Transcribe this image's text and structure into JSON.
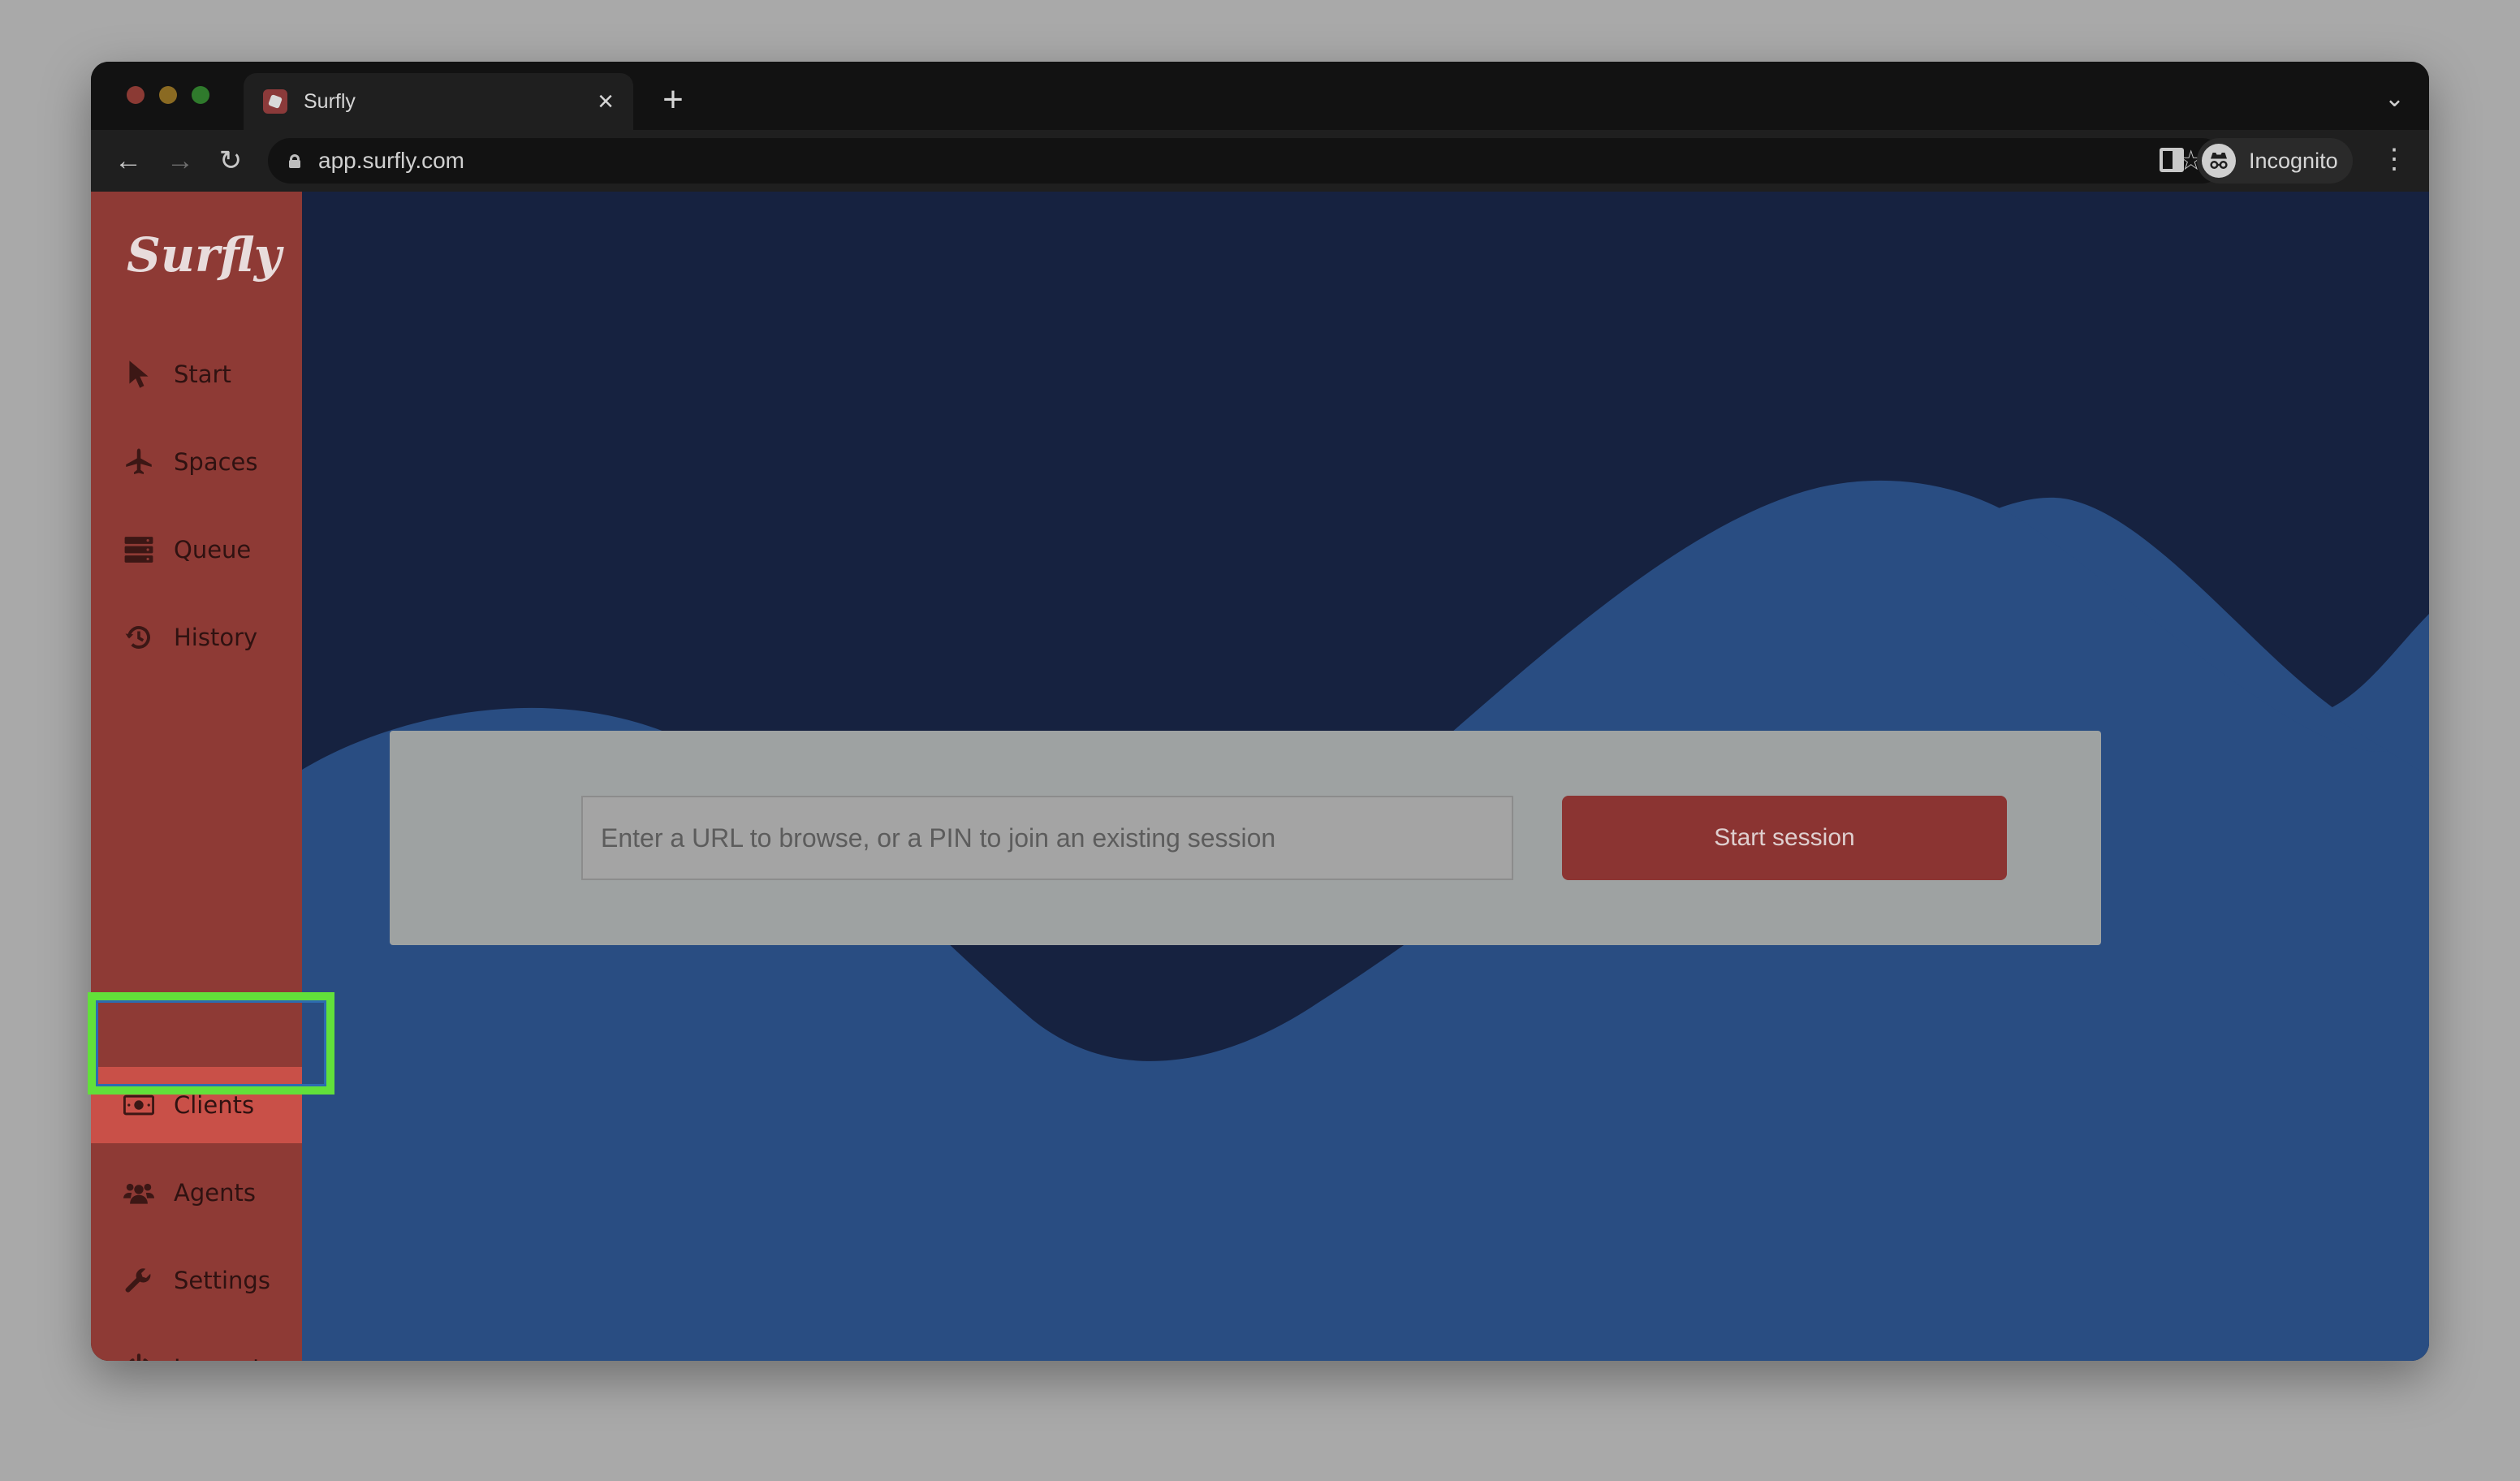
{
  "browser": {
    "tab_title": "Surfly",
    "tab_close": "×",
    "new_tab": "+",
    "tab_menu": "⌄",
    "url": "app.surfly.com",
    "profile_label": "Incognito",
    "back": "←",
    "forward": "→",
    "reload": "↻",
    "star": "☆",
    "kebab": "⋮"
  },
  "app": {
    "logo": "Surfly"
  },
  "sidebar": {
    "items": [
      {
        "label": "Start",
        "icon": "pointer-icon"
      },
      {
        "label": "Spaces",
        "icon": "plane-icon"
      },
      {
        "label": "Queue",
        "icon": "server-stack-icon"
      },
      {
        "label": "History",
        "icon": "history-icon"
      },
      {
        "label": "Clients",
        "icon": "money-bill-icon"
      },
      {
        "label": "Agents",
        "icon": "users-icon"
      },
      {
        "label": "Settings",
        "icon": "wrench-icon"
      },
      {
        "label": "Log out",
        "icon": "power-icon"
      }
    ]
  },
  "session": {
    "placeholder": "Enter a URL to browse, or a PIN to join an existing session",
    "button_label": "Start session"
  },
  "colors": {
    "sidebar": "#8e3a35",
    "active_item": "#c95048",
    "main_bg": "#162240",
    "wave": "#294d82",
    "highlight": "#62e03a",
    "button": "#8b3432"
  }
}
